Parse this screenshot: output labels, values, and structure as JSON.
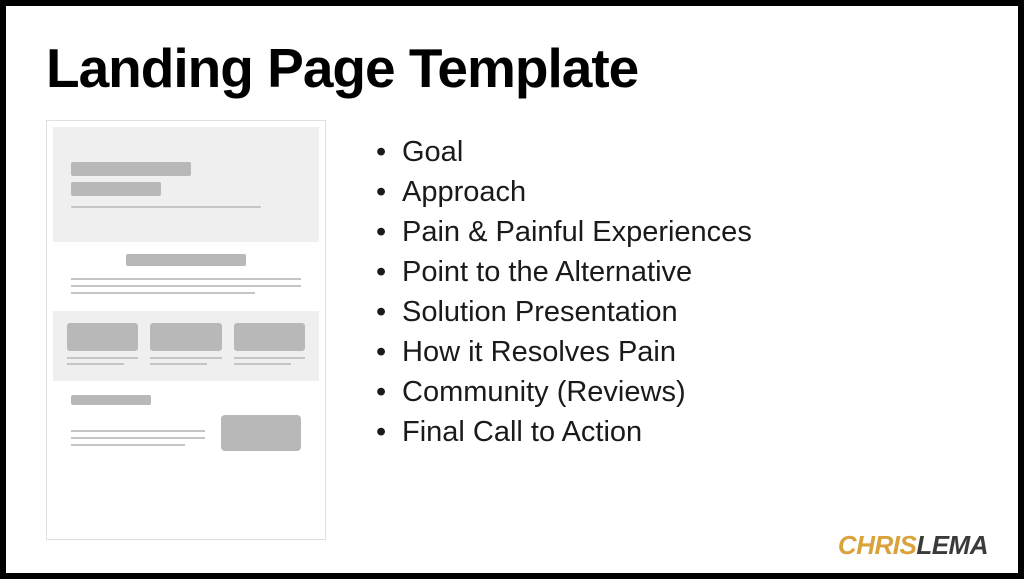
{
  "title": "Landing Page Template",
  "bullets": [
    "Goal",
    "Approach",
    "Pain & Painful Experiences",
    "Point to the Alternative",
    "Solution Presentation",
    "How it Resolves Pain",
    "Community (Reviews)",
    "Final Call to Action"
  ],
  "logo": {
    "part1": "CHRIS",
    "part2": "LEMA"
  }
}
